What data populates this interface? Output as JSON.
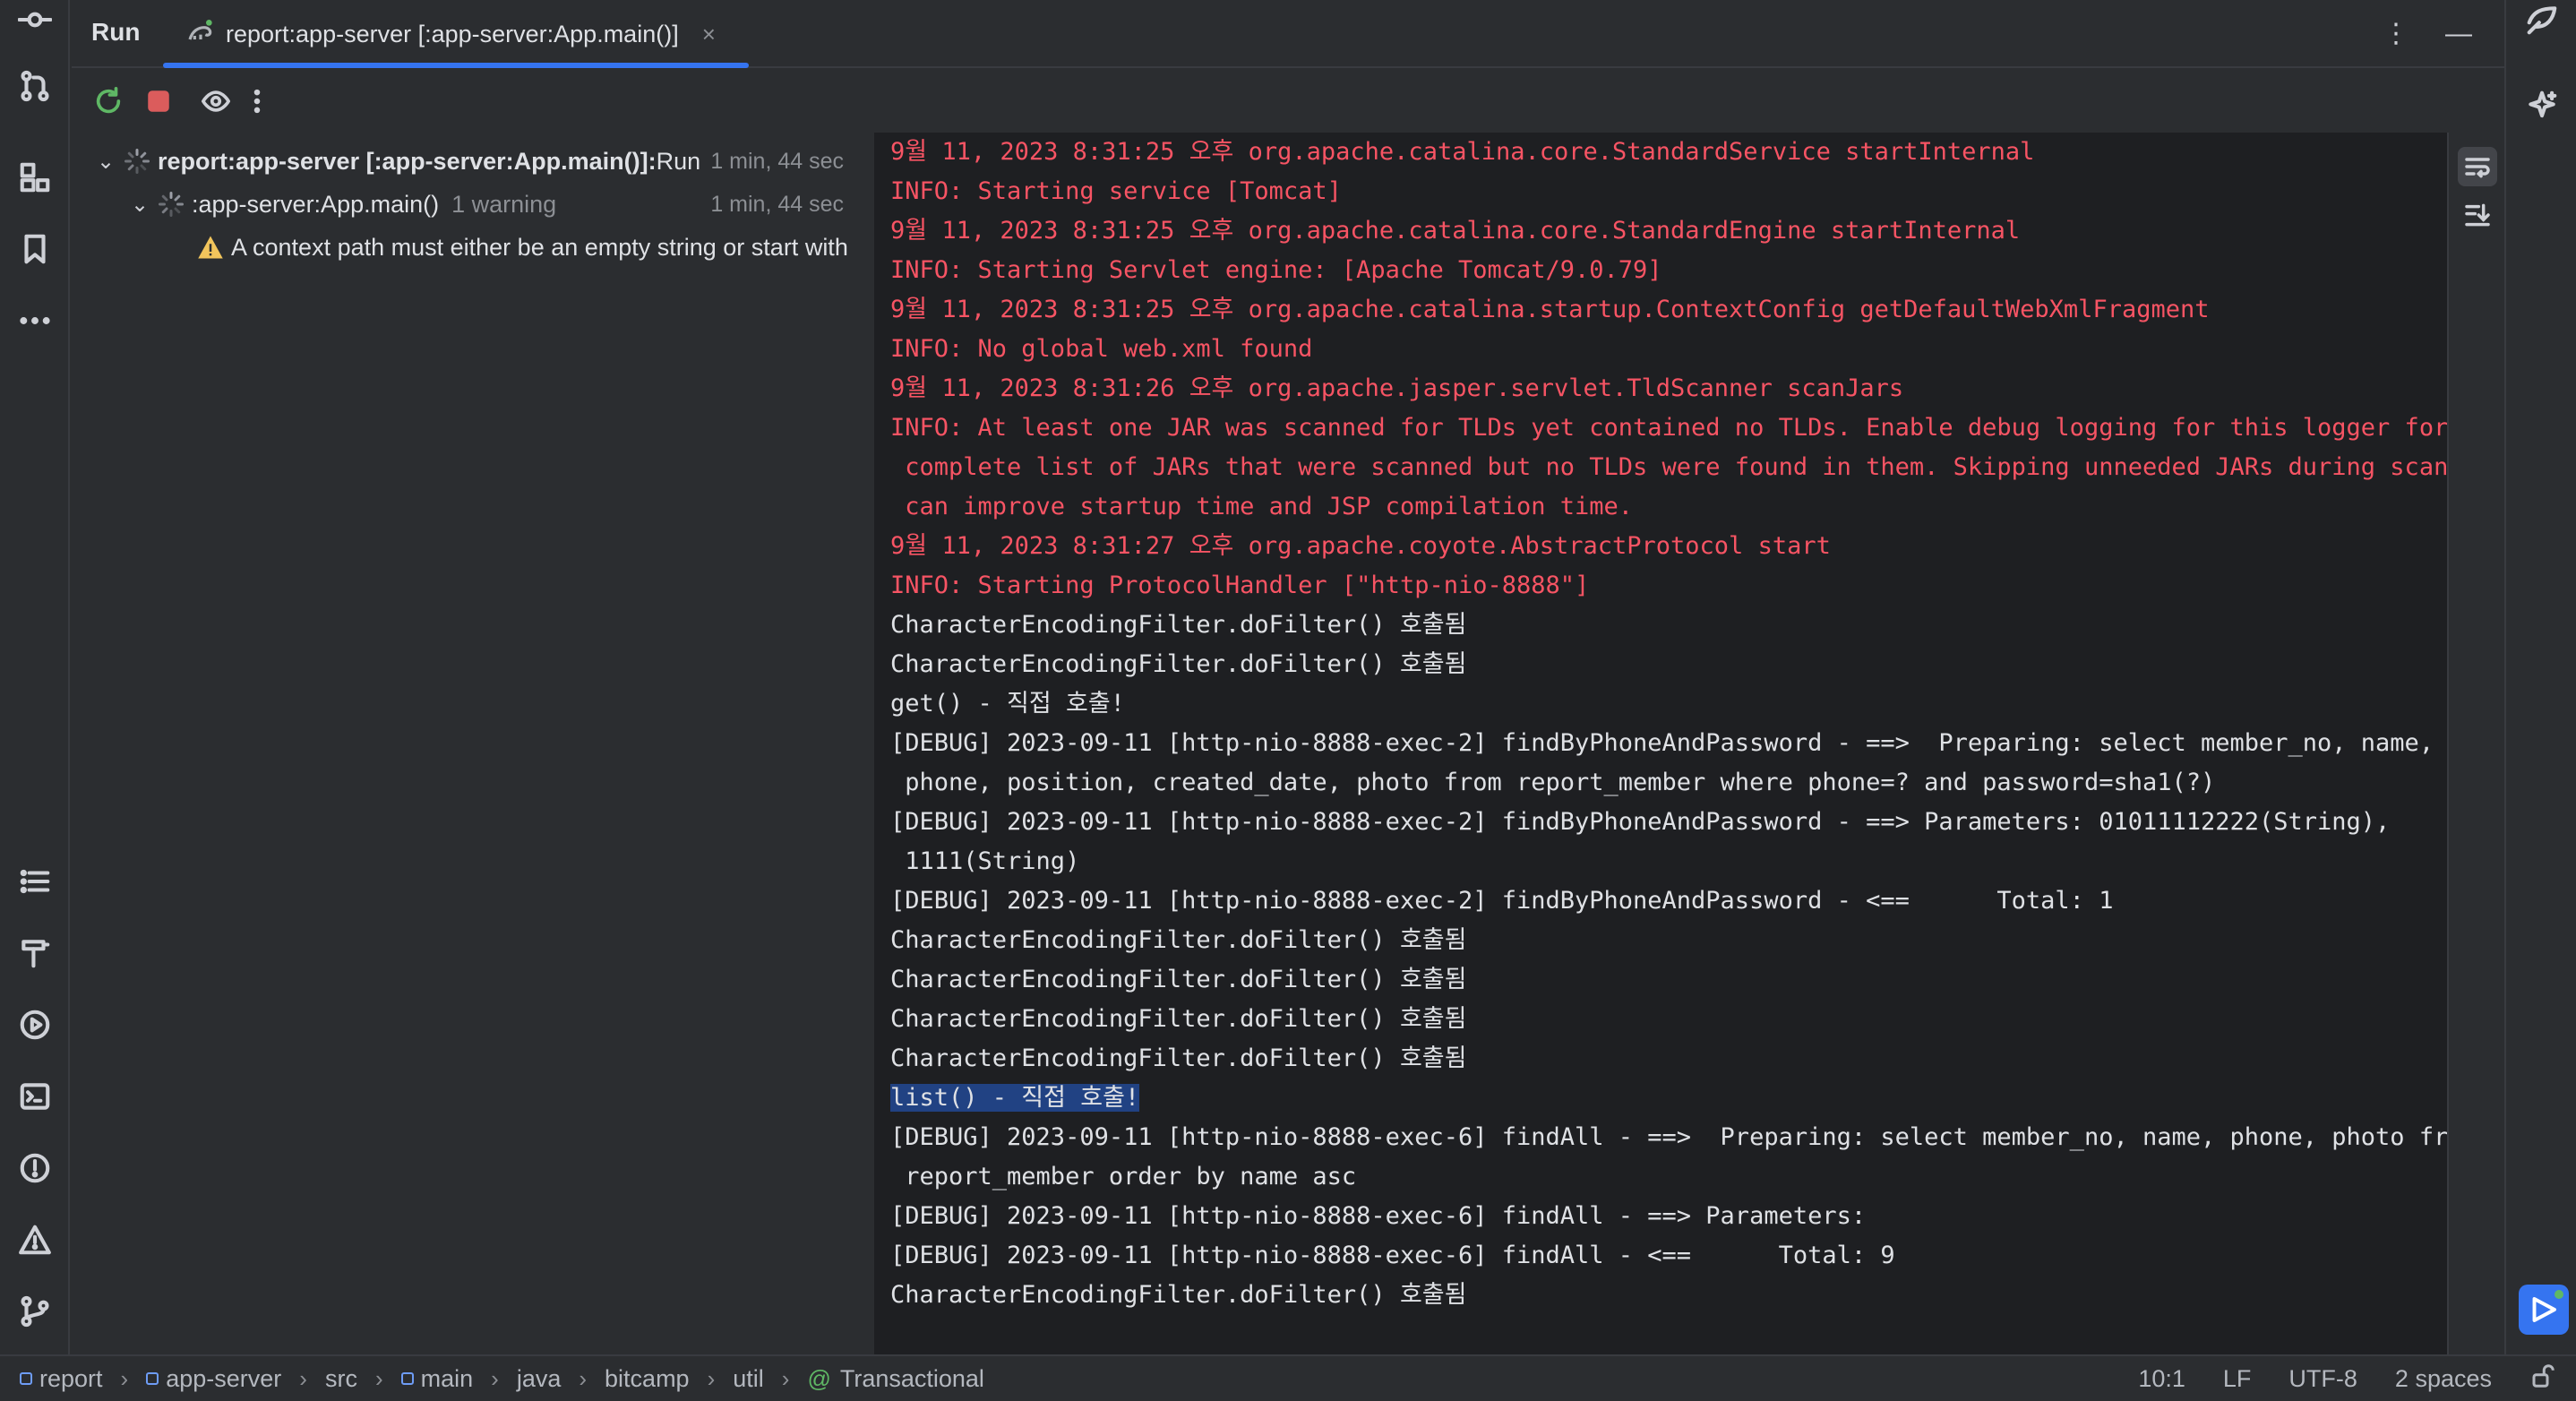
{
  "colors": {
    "accent": "#3574f0",
    "error_text": "#f75464",
    "selection": "#214283",
    "warning": "#f2c55c",
    "success": "#5fb865"
  },
  "tabs": {
    "run_label": "Run",
    "active_title": "report:app-server [:app-server:App.main()]",
    "close": "×"
  },
  "tree": {
    "root": {
      "label": "report:app-server [:app-server:App.main()]:",
      "suffix": " Run",
      "time": "1 min, 44 sec"
    },
    "child": {
      "label": ":app-server:App.main()",
      "badge": "1 warning",
      "time": "1 min, 44 sec"
    },
    "warning": {
      "text": "A context path must either be an empty string or start with"
    }
  },
  "console": {
    "lines": [
      {
        "kind": "err",
        "text": "9월 11, 2023 8:31:25 오후 org.apache.catalina.core.StandardService startInternal"
      },
      {
        "kind": "err",
        "text": "INFO: Starting service [Tomcat]"
      },
      {
        "kind": "err",
        "text": "9월 11, 2023 8:31:25 오후 org.apache.catalina.core.StandardEngine startInternal"
      },
      {
        "kind": "err",
        "text": "INFO: Starting Servlet engine: [Apache Tomcat/9.0.79]"
      },
      {
        "kind": "err",
        "text": "9월 11, 2023 8:31:25 오후 org.apache.catalina.startup.ContextConfig getDefaultWebXmlFragment"
      },
      {
        "kind": "err",
        "text": "INFO: No global web.xml found"
      },
      {
        "kind": "err",
        "text": "9월 11, 2023 8:31:26 오후 org.apache.jasper.servlet.TldScanner scanJars"
      },
      {
        "kind": "err",
        "text": "INFO: At least one JAR was scanned for TLDs yet contained no TLDs. Enable debug logging for this logger for a"
      },
      {
        "kind": "err",
        "text": " complete list of JARs that were scanned but no TLDs were found in them. Skipping unneeded JARs during scanning"
      },
      {
        "kind": "err",
        "text": " can improve startup time and JSP compilation time."
      },
      {
        "kind": "err",
        "text": "9월 11, 2023 8:31:27 오후 org.apache.coyote.AbstractProtocol start"
      },
      {
        "kind": "err",
        "text": "INFO: Starting ProtocolHandler [\"http-nio-8888\"]"
      },
      {
        "kind": "out",
        "text": "CharacterEncodingFilter.doFilter() 호출됨"
      },
      {
        "kind": "out",
        "text": "CharacterEncodingFilter.doFilter() 호출됨"
      },
      {
        "kind": "out",
        "text": "get() - 직접 호출!"
      },
      {
        "kind": "out",
        "text": "[DEBUG] 2023-09-11 [http-nio-8888-exec-2] findByPhoneAndPassword - ==>  Preparing: select member_no, name,"
      },
      {
        "kind": "out",
        "text": " phone, position, created_date, photo from report_member where phone=? and password=sha1(?)"
      },
      {
        "kind": "out",
        "text": "[DEBUG] 2023-09-11 [http-nio-8888-exec-2] findByPhoneAndPassword - ==> Parameters: 01011112222(String),"
      },
      {
        "kind": "out",
        "text": " 1111(String)"
      },
      {
        "kind": "out",
        "text": "[DEBUG] 2023-09-11 [http-nio-8888-exec-2] findByPhoneAndPassword - <==      Total: 1"
      },
      {
        "kind": "out",
        "text": "CharacterEncodingFilter.doFilter() 호출됨"
      },
      {
        "kind": "out",
        "text": "CharacterEncodingFilter.doFilter() 호출됨"
      },
      {
        "kind": "out",
        "text": "CharacterEncodingFilter.doFilter() 호출됨"
      },
      {
        "kind": "out",
        "text": "CharacterEncodingFilter.doFilter() 호출됨"
      },
      {
        "kind": "sel",
        "text": "list() - 직접 호출!"
      },
      {
        "kind": "out",
        "text": "[DEBUG] 2023-09-11 [http-nio-8888-exec-6] findAll - ==>  Preparing: select member_no, name, phone, photo from"
      },
      {
        "kind": "out",
        "text": " report_member order by name asc"
      },
      {
        "kind": "out",
        "text": "[DEBUG] 2023-09-11 [http-nio-8888-exec-6] findAll - ==> Parameters: "
      },
      {
        "kind": "out",
        "text": "[DEBUG] 2023-09-11 [http-nio-8888-exec-6] findAll - <==      Total: 9"
      },
      {
        "kind": "out",
        "text": "CharacterEncodingFilter.doFilter() 호출됨"
      }
    ]
  },
  "statusbar": {
    "breadcrumbs": [
      {
        "label": "report",
        "icon": "module-icon"
      },
      {
        "label": "app-server",
        "icon": "module-icon"
      },
      {
        "label": "src",
        "icon": ""
      },
      {
        "label": "main",
        "icon": "module-icon"
      },
      {
        "label": "java",
        "icon": ""
      },
      {
        "label": "bitcamp",
        "icon": ""
      },
      {
        "label": "util",
        "icon": ""
      },
      {
        "label": "Transactional",
        "icon": "annotation-icon"
      }
    ],
    "position": "10:1",
    "line_ending": "LF",
    "encoding": "UTF-8",
    "indent": "2 spaces"
  }
}
